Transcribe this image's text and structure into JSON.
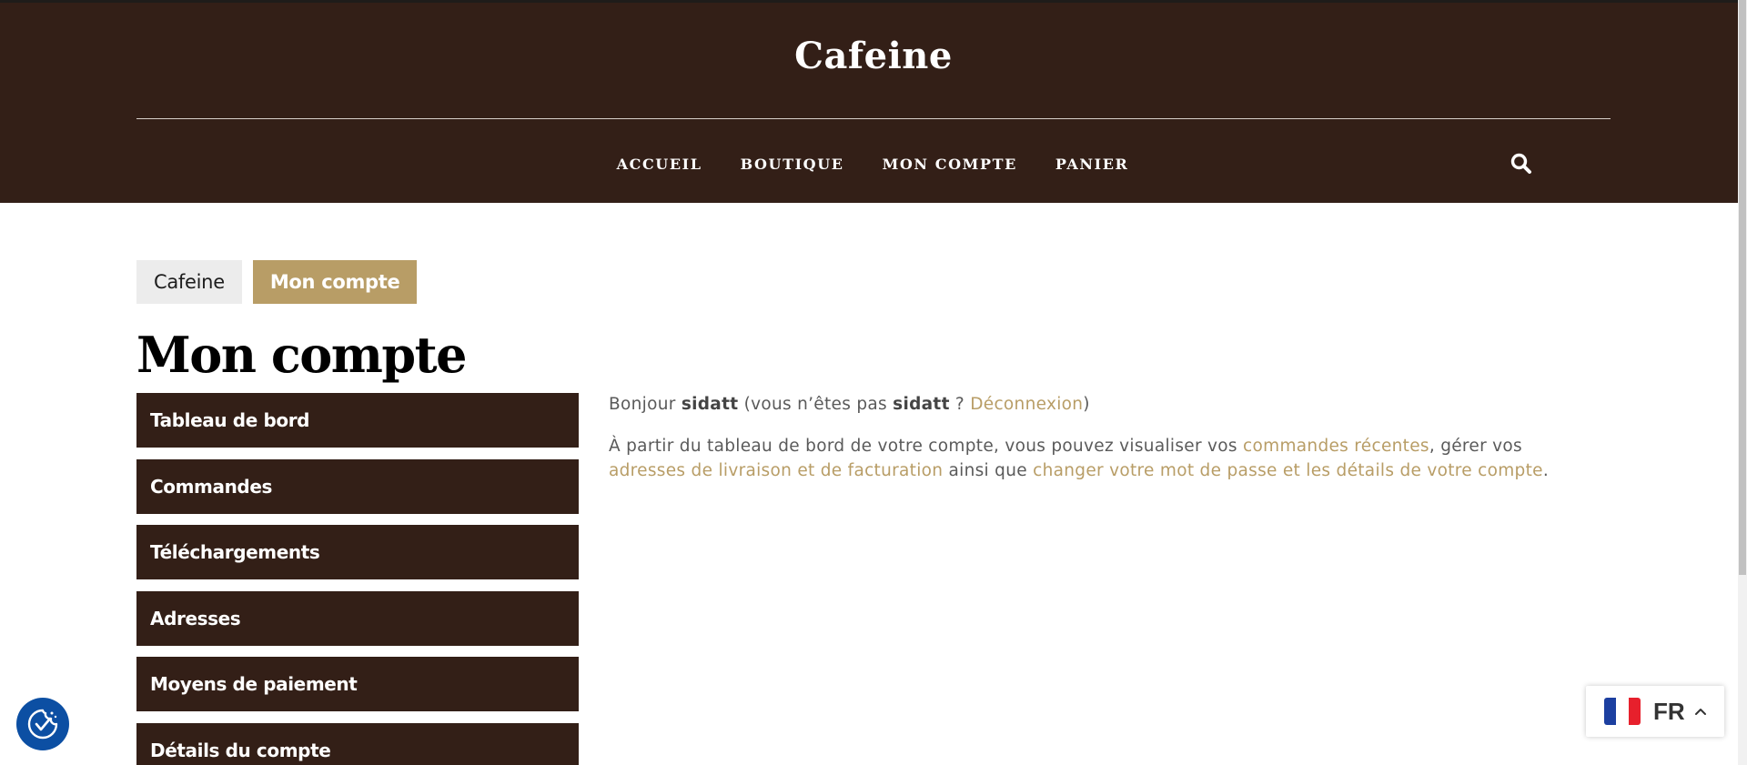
{
  "header": {
    "site_title": "Cafeine",
    "nav": [
      "ACCUEIL",
      "BOUTIQUE",
      "MON COMPTE",
      "PANIER"
    ],
    "search_icon": "search-icon",
    "background_color": "#331f17"
  },
  "breadcrumb": {
    "home": "Cafeine",
    "current": "Mon compte"
  },
  "page": {
    "title": "Mon compte"
  },
  "account_nav": {
    "items": [
      "Tableau de bord",
      "Commandes",
      "Téléchargements",
      "Adresses",
      "Moyens de paiement",
      "Détails du compte"
    ]
  },
  "content": {
    "greeting": {
      "hello": "Bonjour",
      "user": "sidatt",
      "not_prefix": "(vous n’êtes pas",
      "user_repeat": "sidatt",
      "question": "?",
      "logout_link": "Déconnexion",
      "close_paren": ")"
    },
    "dashboard": {
      "intro": "À partir du tableau de bord de votre compte, vous pouvez visualiser vos",
      "orders_link": "commandes récentes",
      "manage": ", gérer vos",
      "addresses_link": "adresses de livraison et de facturation",
      "as_well": "ainsi que",
      "account_link": "changer votre mot de passe et les détails de votre compte",
      "end": "."
    }
  },
  "widgets": {
    "consent_icon": "cookie-consent-icon",
    "language": {
      "code": "FR",
      "flag_icon": "france-flag-icon",
      "caret_icon": "chevron-up-icon"
    }
  },
  "colors": {
    "brand_dark": "#331f17",
    "accent_gold": "#b89d66",
    "breadcrumb_grey": "#ececec",
    "consent_blue": "#0c4fa3"
  }
}
